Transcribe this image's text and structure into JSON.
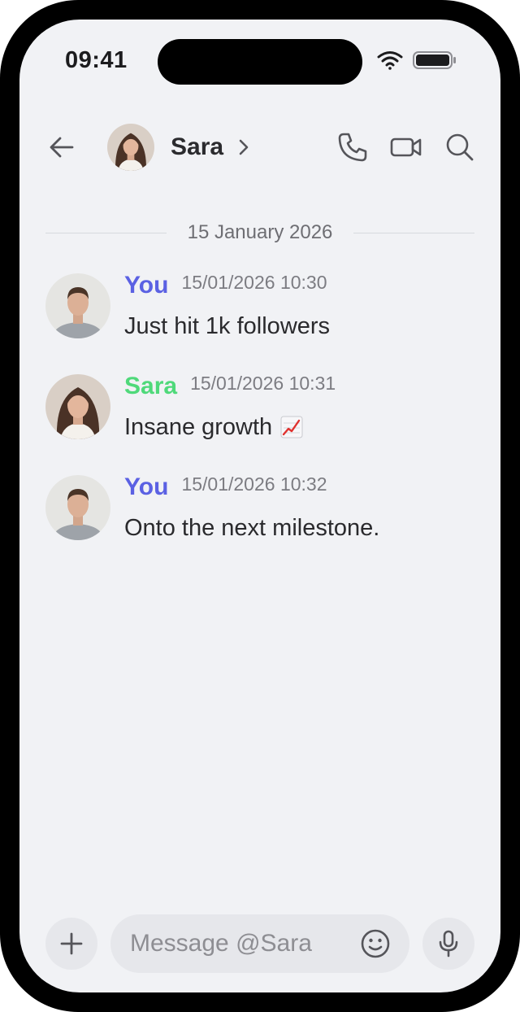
{
  "status_bar": {
    "time": "09:41",
    "icons": [
      "wifi-icon",
      "battery-icon"
    ]
  },
  "header": {
    "back_icon": "arrow-left-icon",
    "contact_name": "Sara",
    "chevron_icon": "chevron-right-icon",
    "actions": [
      "phone-icon",
      "video-camera-icon",
      "search-icon"
    ]
  },
  "date_divider": "15 January 2026",
  "messages": [
    {
      "author": "You",
      "time": "15/01/2026 10:30",
      "text": "Just hit 1k followers",
      "author_color": "#5b61e3"
    },
    {
      "author": "Sara",
      "time": "15/01/2026 10:31",
      "text": "Insane growth",
      "emoji": "chart-increasing-emoji",
      "author_color": "#4fd97a"
    },
    {
      "author": "You",
      "time": "15/01/2026 10:32",
      "text": "Onto the next milestone.",
      "author_color": "#5b61e3"
    }
  ],
  "composer": {
    "placeholder": "Message @Sara",
    "icons": [
      "plus-icon",
      "smiley-icon",
      "microphone-icon"
    ]
  },
  "colors": {
    "background": "#f1f2f5",
    "you_color": "#5b61e3",
    "sara_color": "#4fd97a",
    "input_bg": "#e6e7eb"
  }
}
